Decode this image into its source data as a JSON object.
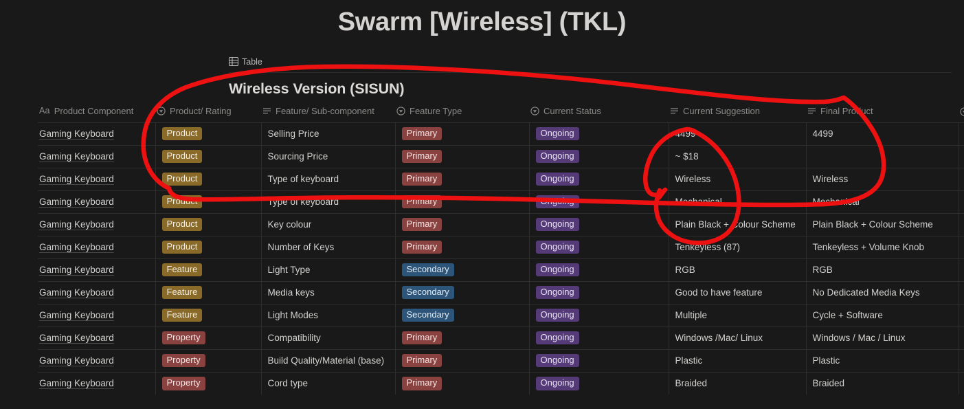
{
  "page": {
    "title": "Swarm [Wireless] (TKL)",
    "background_color": "#191919",
    "accent_annotation_color": "#ee1111"
  },
  "view_bar": {
    "tabs": [
      {
        "label": "Table",
        "icon": "table-icon",
        "active": true
      }
    ]
  },
  "database": {
    "title": "Wireless Version (SISUN)",
    "columns": [
      {
        "key": "product_component",
        "label": "Product Component",
        "icon": "title-aa-icon"
      },
      {
        "key": "product_rating",
        "label": "Product/ Rating",
        "icon": "select-icon"
      },
      {
        "key": "feature_subcomponent",
        "label": "Feature/ Sub-component",
        "icon": "text-lines-icon"
      },
      {
        "key": "feature_type",
        "label": "Feature Type",
        "icon": "select-icon"
      },
      {
        "key": "current_status",
        "label": "Current Status",
        "icon": "select-icon"
      },
      {
        "key": "current_suggestion",
        "label": "Current Suggestion",
        "icon": "text-lines-icon"
      },
      {
        "key": "final_product",
        "label": "Final Product",
        "icon": "text-lines-icon"
      },
      {
        "key": "next_column",
        "label": "",
        "icon": "select-icon"
      }
    ],
    "rows": [
      {
        "product_component": "Gaming Keyboard",
        "product_rating": {
          "text": "Product",
          "color": "product"
        },
        "feature_subcomponent": "Selling Price",
        "feature_type": {
          "text": "Primary",
          "color": "primary"
        },
        "current_status": {
          "text": "Ongoing",
          "color": "ongoing"
        },
        "current_suggestion": "4499",
        "final_product": "4499"
      },
      {
        "product_component": "Gaming Keyboard",
        "product_rating": {
          "text": "Product",
          "color": "product"
        },
        "feature_subcomponent": "Sourcing Price",
        "feature_type": {
          "text": "Primary",
          "color": "primary"
        },
        "current_status": {
          "text": "Ongoing",
          "color": "ongoing"
        },
        "current_suggestion": "~ $18",
        "final_product": ""
      },
      {
        "product_component": "Gaming Keyboard",
        "product_rating": {
          "text": "Product",
          "color": "product"
        },
        "feature_subcomponent": "Type of keyboard",
        "feature_type": {
          "text": "Primary",
          "color": "primary"
        },
        "current_status": {
          "text": "Ongoing",
          "color": "ongoing"
        },
        "current_suggestion": "Wireless",
        "final_product": "Wireless"
      },
      {
        "product_component": "Gaming Keyboard",
        "product_rating": {
          "text": "Product",
          "color": "product"
        },
        "feature_subcomponent": "Type of keyboard",
        "feature_type": {
          "text": "Primary",
          "color": "primary"
        },
        "current_status": {
          "text": "Ongoing",
          "color": "ongoing"
        },
        "current_suggestion": "Mechanical",
        "final_product": "Mechanical"
      },
      {
        "product_component": "Gaming Keyboard",
        "product_rating": {
          "text": "Product",
          "color": "product"
        },
        "feature_subcomponent": "Key colour",
        "feature_type": {
          "text": "Primary",
          "color": "primary"
        },
        "current_status": {
          "text": "Ongoing",
          "color": "ongoing"
        },
        "current_suggestion": "Plain Black + Colour Scheme",
        "final_product": "Plain Black + Colour Scheme"
      },
      {
        "product_component": "Gaming Keyboard",
        "product_rating": {
          "text": "Product",
          "color": "product"
        },
        "feature_subcomponent": "Number of Keys",
        "feature_type": {
          "text": "Primary",
          "color": "primary"
        },
        "current_status": {
          "text": "Ongoing",
          "color": "ongoing"
        },
        "current_suggestion": "Tenkeyless (87)",
        "final_product": "Tenkeyless + Volume Knob"
      },
      {
        "product_component": "Gaming Keyboard",
        "product_rating": {
          "text": "Feature",
          "color": "feature"
        },
        "feature_subcomponent": "Light Type",
        "feature_type": {
          "text": "Secondary",
          "color": "secondary"
        },
        "current_status": {
          "text": "Ongoing",
          "color": "ongoing"
        },
        "current_suggestion": "RGB",
        "final_product": "RGB"
      },
      {
        "product_component": "Gaming Keyboard",
        "product_rating": {
          "text": "Feature",
          "color": "feature"
        },
        "feature_subcomponent": "Media keys",
        "feature_type": {
          "text": "Secondary",
          "color": "secondary"
        },
        "current_status": {
          "text": "Ongoing",
          "color": "ongoing"
        },
        "current_suggestion": "Good to have feature",
        "final_product": "No Dedicated Media Keys"
      },
      {
        "product_component": "Gaming Keyboard",
        "product_rating": {
          "text": "Feature",
          "color": "feature"
        },
        "feature_subcomponent": "Light Modes",
        "feature_type": {
          "text": "Secondary",
          "color": "secondary"
        },
        "current_status": {
          "text": "Ongoing",
          "color": "ongoing"
        },
        "current_suggestion": "Multiple",
        "final_product": "Cycle + Software"
      },
      {
        "product_component": "Gaming Keyboard",
        "product_rating": {
          "text": "Property",
          "color": "property"
        },
        "feature_subcomponent": "Compatibility",
        "feature_type": {
          "text": "Primary",
          "color": "primary"
        },
        "current_status": {
          "text": "Ongoing",
          "color": "ongoing"
        },
        "current_suggestion": "Windows /Mac/ Linux",
        "final_product": "Windows / Mac / Linux"
      },
      {
        "product_component": "Gaming Keyboard",
        "product_rating": {
          "text": "Property",
          "color": "property"
        },
        "feature_subcomponent": "Build Quality/Material (base)",
        "feature_type": {
          "text": "Primary",
          "color": "primary"
        },
        "current_status": {
          "text": "Ongoing",
          "color": "ongoing"
        },
        "current_suggestion": "Plastic",
        "final_product": "Plastic"
      },
      {
        "product_component": "Gaming Keyboard",
        "product_rating": {
          "text": "Property",
          "color": "property"
        },
        "feature_subcomponent": "Cord type",
        "feature_type": {
          "text": "Primary",
          "color": "primary"
        },
        "current_status": {
          "text": "Ongoing",
          "color": "ongoing"
        },
        "current_suggestion": "Braided",
        "final_product": "Braided"
      }
    ]
  },
  "annotations": [
    {
      "name": "outer-circle-highlight",
      "shape": "hand-drawn-ellipse",
      "color": "#ee1111"
    },
    {
      "name": "inner-circle-highlight",
      "shape": "hand-drawn-ellipse",
      "color": "#ee1111"
    }
  ]
}
